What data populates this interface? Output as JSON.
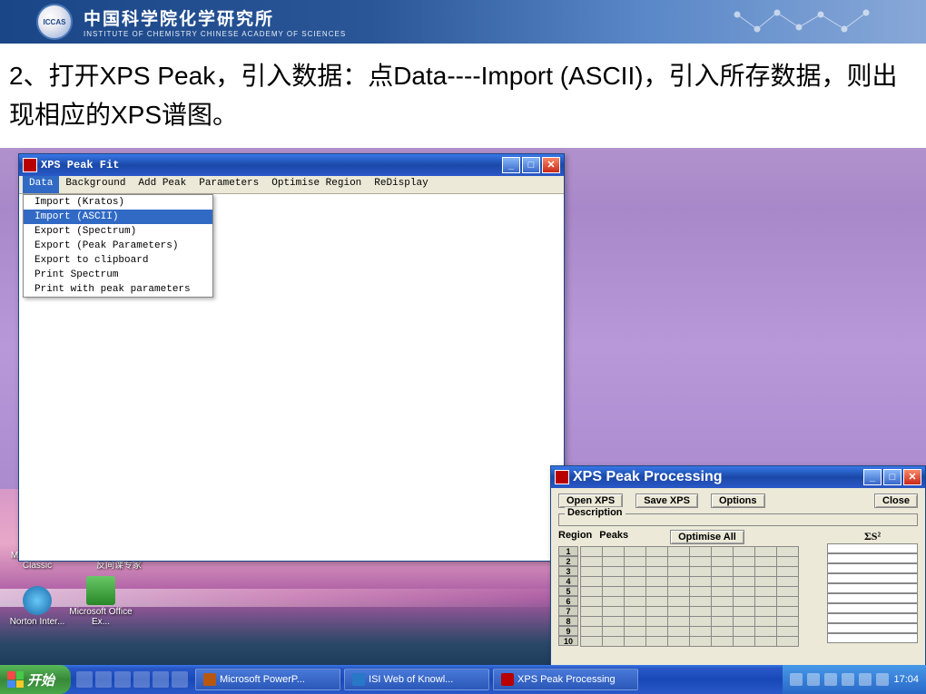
{
  "banner": {
    "org_cn": "中国科学院化学研究所",
    "org_en": "INSTITUTE OF CHEMISTRY  CHINESE ACADEMY OF SCIENCES",
    "logo_txt": "ICCAS"
  },
  "slide": {
    "instruction": "2、打开XPS Peak，引入数据：点Data----Import (ASCII)，引入所存数据，则出现相应的XPS谱图。"
  },
  "fit_window": {
    "title": "XPS Peak Fit",
    "menubar": [
      "Data",
      "Background",
      "Add Peak",
      "Parameters",
      "Optimise Region",
      "ReDisplay"
    ],
    "active_menu": 0,
    "dropdown": [
      "Import (Kratos)",
      "Import (ASCII)",
      "Export (Spectrum)",
      "Export (Peak Parameters)",
      "Export to clipboard",
      "Print Spectrum",
      "Print with peak parameters"
    ],
    "highlight_index": 1
  },
  "proc_window": {
    "title": "XPS Peak Processing",
    "buttons": {
      "open": "Open XPS",
      "save": "Save XPS",
      "options": "Options",
      "close": "Close"
    },
    "description_label": "Description",
    "optimise_all": "Optimise All",
    "col_region": "Region",
    "col_peaks": "Peaks",
    "sigma_label": "ΣS²",
    "row_numbers": [
      "1",
      "2",
      "3",
      "4",
      "5",
      "6",
      "7",
      "8",
      "9",
      "10"
    ]
  },
  "desktop_icons": {
    "media_player": "Media Player Classic",
    "fanjian": "反间谍专家",
    "norton": "Norton Inter...",
    "office": "Microsoft Office Ex..."
  },
  "taskbar": {
    "start": "开始",
    "items": [
      "Microsoft PowerP...",
      "ISI Web of Knowl...",
      "XPS Peak Processing"
    ],
    "clock": "17:04"
  },
  "win_controls": {
    "min": "_",
    "max": "□",
    "close": "✕"
  }
}
